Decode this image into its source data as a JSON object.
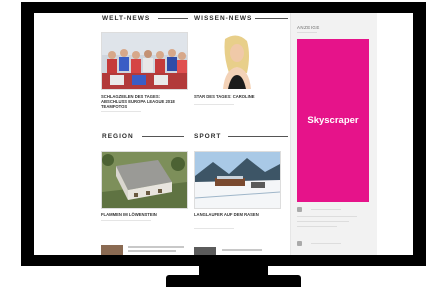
{
  "sections": {
    "welt": "WELT-NEWS",
    "wissen": "WISSEN-NEWS",
    "region": "REGION",
    "sport": "SPORT"
  },
  "articles": [
    {
      "caption": "SCHLAGZEILEN DES TAGES: ABSCHLUSS EUROPA LEAGUE 2018 TEAMFOTOS"
    },
    {
      "caption": "STAR DES TAGES: CAROLINE"
    },
    {
      "caption": "FLAMMEN IM LÖWENSTEIN"
    },
    {
      "caption": "LANGLAUFER AUF DEM RASEN"
    }
  ],
  "sidebar": {
    "label": "ANZEIGE",
    "ad_text": "Skyscraper"
  }
}
